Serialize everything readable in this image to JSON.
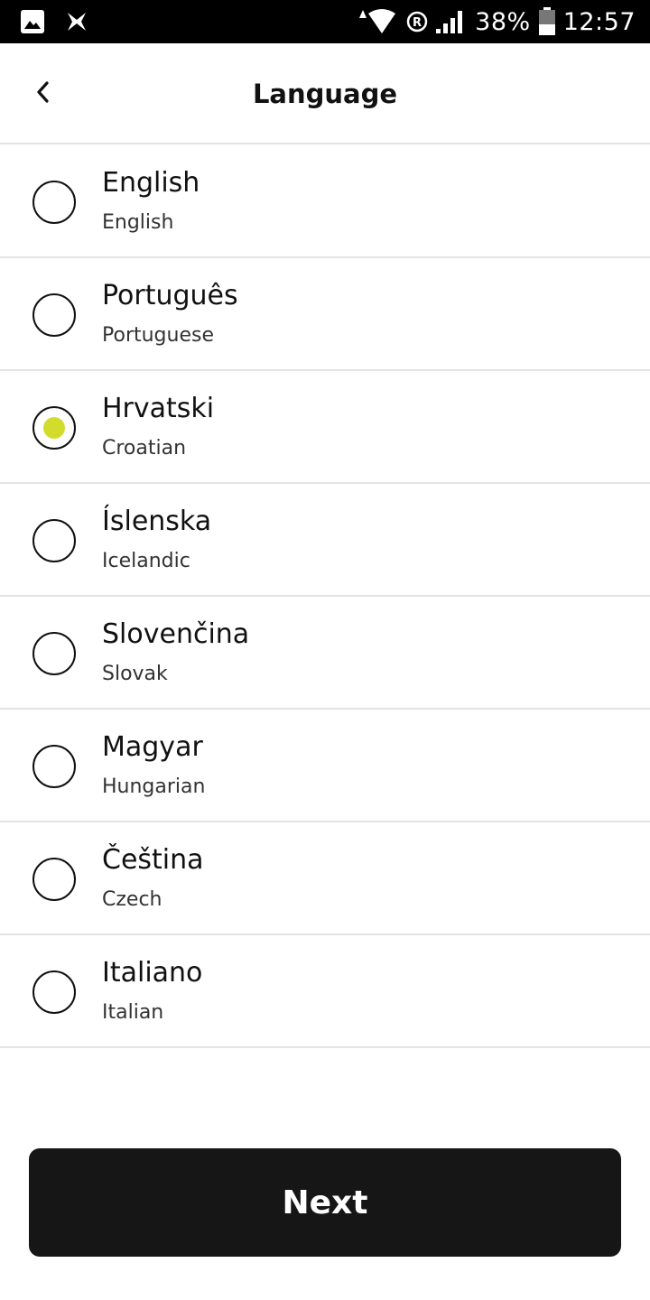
{
  "status_bar": {
    "battery_percent": "38%",
    "time": "12:57",
    "icons": [
      "gallery-icon",
      "app-notification-icon",
      "wifi-icon",
      "registered-icon",
      "signal-icon",
      "battery-icon"
    ]
  },
  "header": {
    "title": "Language",
    "back_icon": "chevron-left-icon"
  },
  "languages": [
    {
      "name": "English",
      "sub": "English",
      "selected": false
    },
    {
      "name": "Português",
      "sub": "Portuguese",
      "selected": false
    },
    {
      "name": "Hrvatski",
      "sub": "Croatian",
      "selected": true
    },
    {
      "name": "Íslenska",
      "sub": "Icelandic",
      "selected": false
    },
    {
      "name": "Slovenčina",
      "sub": "Slovak",
      "selected": false
    },
    {
      "name": "Magyar",
      "sub": "Hungarian",
      "selected": false
    },
    {
      "name": "Čeština",
      "sub": "Czech",
      "selected": false
    },
    {
      "name": "Italiano",
      "sub": "Italian",
      "selected": false
    }
  ],
  "footer": {
    "next_label": "Next"
  },
  "colors": {
    "accent": "#d2dc2c",
    "button_bg": "#161616",
    "divider": "#e3e3e3"
  }
}
